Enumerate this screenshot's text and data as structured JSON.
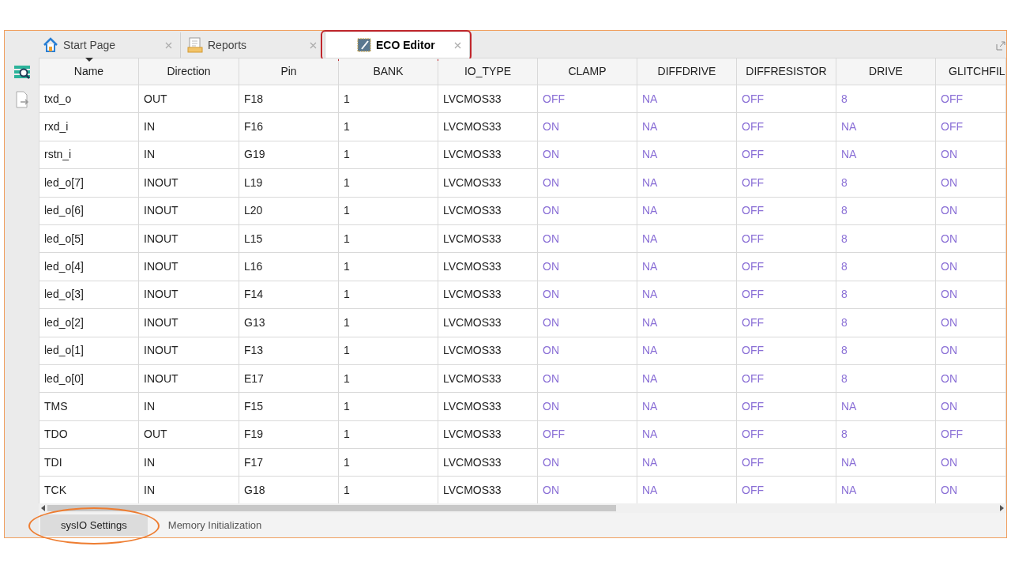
{
  "tabs": [
    {
      "label": "Start Page",
      "selected": false,
      "highlighted": false
    },
    {
      "label": "Reports",
      "selected": false,
      "highlighted": false
    },
    {
      "label": "ECO Editor",
      "selected": true,
      "highlighted": true
    }
  ],
  "table": {
    "columns": [
      {
        "label": "Name",
        "kind": "fixed",
        "sorted": true
      },
      {
        "label": "Direction",
        "kind": "fixed",
        "sorted": false
      },
      {
        "label": "Pin",
        "kind": "fixed",
        "sorted": false
      },
      {
        "label": "BANK",
        "kind": "fixed",
        "sorted": false
      },
      {
        "label": "IO_TYPE",
        "kind": "fixed",
        "sorted": false
      },
      {
        "label": "CLAMP",
        "kind": "attribute",
        "sorted": false
      },
      {
        "label": "DIFFDRIVE",
        "kind": "attribute",
        "sorted": false
      },
      {
        "label": "DIFFRESISTOR",
        "kind": "attribute",
        "sorted": false
      },
      {
        "label": "DRIVE",
        "kind": "attribute",
        "sorted": false
      },
      {
        "label": "GLITCHFIL",
        "kind": "attribute",
        "sorted": false
      }
    ],
    "rows": [
      [
        "txd_o",
        "OUT",
        "F18",
        "1",
        "LVCMOS33",
        "OFF",
        "NA",
        "OFF",
        "8",
        "OFF"
      ],
      [
        "rxd_i",
        "IN",
        "F16",
        "1",
        "LVCMOS33",
        "ON",
        "NA",
        "OFF",
        "NA",
        "OFF"
      ],
      [
        "rstn_i",
        "IN",
        "G19",
        "1",
        "LVCMOS33",
        "ON",
        "NA",
        "OFF",
        "NA",
        "ON"
      ],
      [
        "led_o[7]",
        "INOUT",
        "L19",
        "1",
        "LVCMOS33",
        "ON",
        "NA",
        "OFF",
        "8",
        "ON"
      ],
      [
        "led_o[6]",
        "INOUT",
        "L20",
        "1",
        "LVCMOS33",
        "ON",
        "NA",
        "OFF",
        "8",
        "ON"
      ],
      [
        "led_o[5]",
        "INOUT",
        "L15",
        "1",
        "LVCMOS33",
        "ON",
        "NA",
        "OFF",
        "8",
        "ON"
      ],
      [
        "led_o[4]",
        "INOUT",
        "L16",
        "1",
        "LVCMOS33",
        "ON",
        "NA",
        "OFF",
        "8",
        "ON"
      ],
      [
        "led_o[3]",
        "INOUT",
        "F14",
        "1",
        "LVCMOS33",
        "ON",
        "NA",
        "OFF",
        "8",
        "ON"
      ],
      [
        "led_o[2]",
        "INOUT",
        "G13",
        "1",
        "LVCMOS33",
        "ON",
        "NA",
        "OFF",
        "8",
        "ON"
      ],
      [
        "led_o[1]",
        "INOUT",
        "F13",
        "1",
        "LVCMOS33",
        "ON",
        "NA",
        "OFF",
        "8",
        "ON"
      ],
      [
        "led_o[0]",
        "INOUT",
        "E17",
        "1",
        "LVCMOS33",
        "ON",
        "NA",
        "OFF",
        "8",
        "ON"
      ],
      [
        "TMS",
        "IN",
        "F15",
        "1",
        "LVCMOS33",
        "ON",
        "NA",
        "OFF",
        "NA",
        "ON"
      ],
      [
        "TDO",
        "OUT",
        "F19",
        "1",
        "LVCMOS33",
        "OFF",
        "NA",
        "OFF",
        "8",
        "OFF"
      ],
      [
        "TDI",
        "IN",
        "F17",
        "1",
        "LVCMOS33",
        "ON",
        "NA",
        "OFF",
        "NA",
        "ON"
      ],
      [
        "TCK",
        "IN",
        "G18",
        "1",
        "LVCMOS33",
        "ON",
        "NA",
        "OFF",
        "NA",
        "ON"
      ]
    ]
  },
  "bottom_tabs": [
    {
      "label": "sysIO Settings",
      "selected": true,
      "highlighted": true
    },
    {
      "label": "Memory Initialization",
      "selected": false,
      "highlighted": false
    }
  ]
}
